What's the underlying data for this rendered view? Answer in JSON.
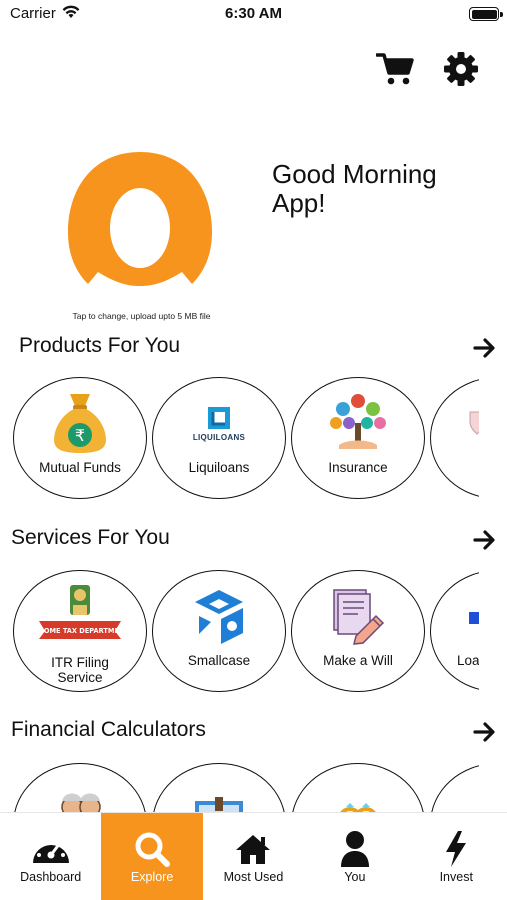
{
  "status_bar": {
    "carrier": "Carrier",
    "time": "6:30 AM"
  },
  "header": {
    "icons": [
      "cart-icon",
      "settings-gear-icon"
    ],
    "greeting": "Good Morning\nApp!",
    "upload_hint": "Tap to change, upload upto 5 MB file"
  },
  "sections": {
    "products": {
      "title": "Products For You",
      "items": [
        {
          "label": "Mutual Funds",
          "icon": "money-bag-rupee-icon"
        },
        {
          "label": "Liquiloans",
          "icon": "liquiloans-logo",
          "logo_text": "LIQUILOANS"
        },
        {
          "label": "Insurance",
          "icon": "insurance-tree-icon"
        },
        {
          "label": "",
          "icon": "shield-icon"
        }
      ]
    },
    "services": {
      "title": "Services For You",
      "items": [
        {
          "label": "ITR Filing\nService",
          "icon": "income-tax-department-emblem",
          "emblem_text": "INCOME TAX DEPARTMENT"
        },
        {
          "label": "Smallcase",
          "icon": "smallcase-cube-icon"
        },
        {
          "label": "Make a Will",
          "icon": "will-document-pen-icon"
        },
        {
          "label": "Loa",
          "icon": "loan-icon"
        }
      ]
    },
    "calculators": {
      "title": "Financial Calculators",
      "items": [
        {
          "label": "",
          "icon": "retirement-couple-icon"
        },
        {
          "label": "",
          "icon": "education-book-icon"
        },
        {
          "label": "",
          "icon": "marriage-rings-icon"
        },
        {
          "label": "",
          "icon": "chart-icon"
        }
      ]
    }
  },
  "tab_bar": {
    "active": "Explore",
    "accent_color": "#f7941d",
    "tabs": [
      {
        "label": "Dashboard",
        "icon": "speedometer-icon"
      },
      {
        "label": "Explore",
        "icon": "search-icon"
      },
      {
        "label": "Most Used",
        "icon": "home-icon"
      },
      {
        "label": "You",
        "icon": "user-icon"
      },
      {
        "label": "Invest",
        "icon": "lightning-icon"
      }
    ]
  },
  "colors": {
    "brand_orange": "#f7941d",
    "text": "#111111",
    "background": "#ffffff"
  }
}
